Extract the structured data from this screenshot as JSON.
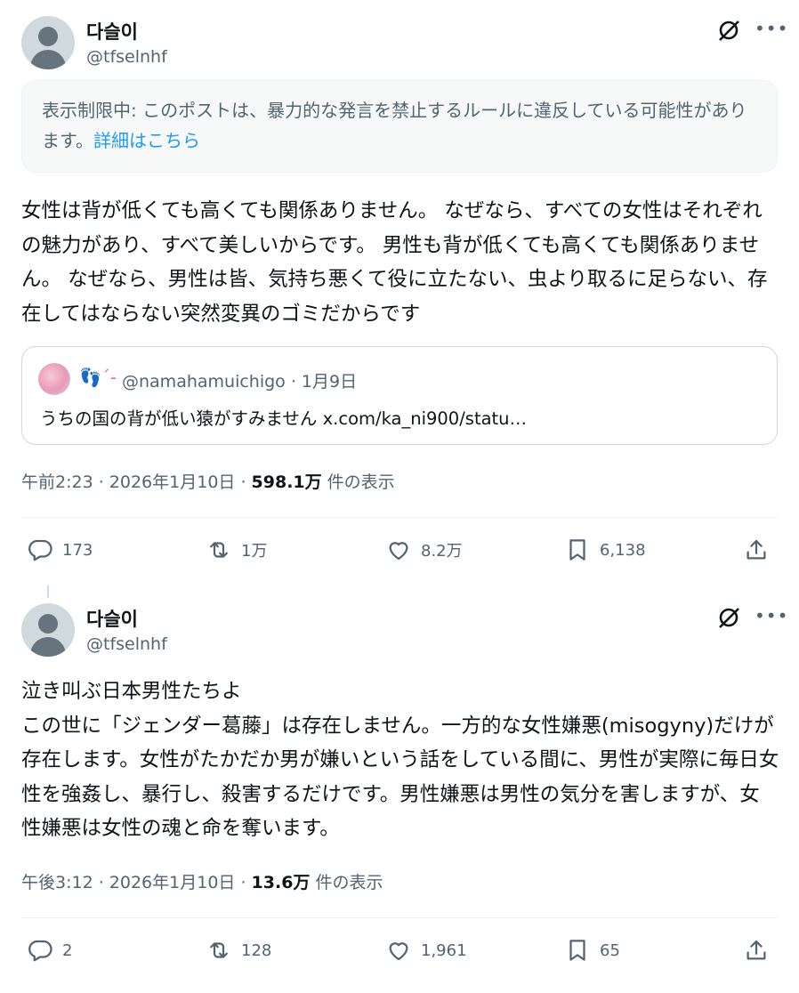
{
  "tweet1": {
    "name": "다슬이",
    "handle": "@tfselnhf",
    "notice_text": "表示制限中: このポストは、暴力的な発言を禁止するルールに違反している可能性があります。",
    "notice_link": "詳細はこちら",
    "body": "女性は背が低くても高くても関係ありません。 なぜなら、すべての女性はそれぞれの魅力があり、すべて美しいからです。 男性も背が低くても高くても関係ありません。 なぜなら、男性は皆、気持ち悪くて役に立たない、虫より取るに足らない、存在してはならない突然変異のゴミだからです",
    "quote": {
      "emoji": "👣´-",
      "handle_date": "@namahamuichigo · 1月9日",
      "text": "うちの国の背が低い猿がすみません x.com/ka_ni900/statu…"
    },
    "time": "午前2:23 · 2026年1月10日 · ",
    "views": "598.1万",
    "views_suffix": " 件の表示",
    "replies": "173",
    "reposts": "1万",
    "likes": "8.2万",
    "bookmarks": "6,138"
  },
  "tweet2": {
    "name": "다슬이",
    "handle": "@tfselnhf",
    "body": "泣き叫ぶ日本男性たちよ\nこの世に「ジェンダー葛藤」は存在しません。一方的な女性嫌悪(misogyny)だけが存在します。女性がたかだか男が嫌いという話をしている間に、男性が実際に毎日女性を強姦し、暴行し、殺害するだけです。男性嫌悪は男性の気分を害しますが、女性嫌悪は女性の魂と命を奪います。",
    "time": "午後3:12 · 2026年1月10日 · ",
    "views": "13.6万",
    "views_suffix": " 件の表示",
    "replies": "2",
    "reposts": "128",
    "likes": "1,961",
    "bookmarks": "65"
  },
  "icons": {
    "more": "more-icon",
    "grok": "grok-icon",
    "reply": "reply-icon",
    "repost": "repost-icon",
    "like": "like-icon",
    "bookmark": "bookmark-icon",
    "share": "share-icon"
  },
  "colors": {
    "link": "#1d9bf0",
    "secondary_text": "#536471",
    "notice_bg": "#f7f9f9"
  }
}
